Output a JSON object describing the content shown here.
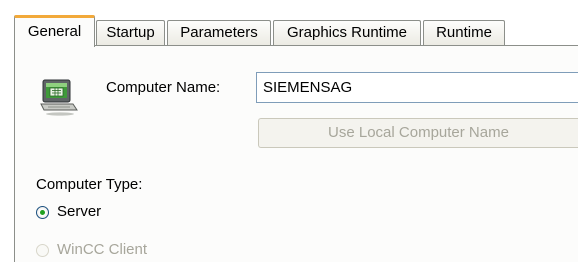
{
  "tabs": [
    {
      "label": "General",
      "active": true
    },
    {
      "label": "Startup",
      "active": false
    },
    {
      "label": "Parameters",
      "active": false
    },
    {
      "label": "Graphics Runtime",
      "active": false
    },
    {
      "label": "Runtime",
      "active": false
    }
  ],
  "general": {
    "computer_name_label": "Computer Name:",
    "computer_name_value": "SIEMENSAG",
    "use_local_button_label": "Use Local Computer Name",
    "computer_type_label": "Computer Type:",
    "server_option_label": "Server",
    "server_selected": true,
    "wincc_client_option_label": "WinCC Client",
    "wincc_client_enabled": false
  },
  "colors": {
    "active_tab_accent": "#f2a93a",
    "radio_dot": "#21a121",
    "disabled_text": "#a7a69b"
  },
  "icons": {
    "computer": "computer-icon"
  }
}
